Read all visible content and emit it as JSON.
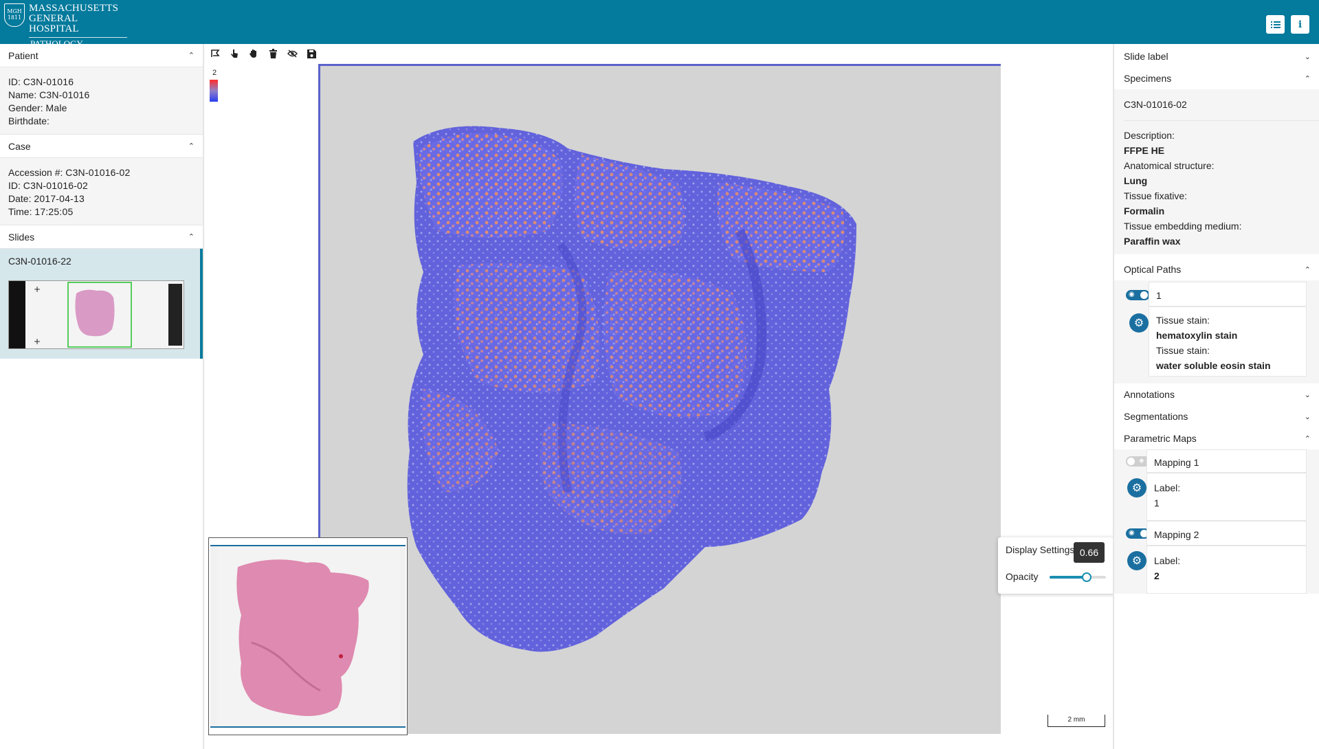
{
  "header": {
    "logo_line1": "MASSACHUSETTS",
    "logo_line2": "GENERAL HOSPITAL",
    "logo_line3": "PATHOLOGY",
    "logo_seal": "MGH 1811",
    "list_icon": "list-icon",
    "info_icon": "info-icon",
    "info_label": "i"
  },
  "patient": {
    "title": "Patient",
    "id_label": "ID:",
    "id": "C3N-01016",
    "name_label": "Name:",
    "name": "C3N-01016",
    "gender_label": "Gender:",
    "gender": "Male",
    "birthdate_label": "Birthdate:",
    "birthdate": ""
  },
  "case": {
    "title": "Case",
    "accession_label": "Accession #:",
    "accession": "C3N-01016-02",
    "id_label": "ID:",
    "id": "C3N-01016-02",
    "date_label": "Date:",
    "date": "2017-04-13",
    "time_label": "Time:",
    "time": "17:25:05"
  },
  "slides": {
    "title": "Slides",
    "items": [
      {
        "label": "C3N-01016-22"
      }
    ]
  },
  "toolbar": {
    "tools": [
      "draw-icon",
      "pointer-icon",
      "pan-icon",
      "trash-icon",
      "eye-slash-icon",
      "save-icon"
    ]
  },
  "viewer": {
    "legend_value": "2",
    "scale_label": "2 mm"
  },
  "display_settings": {
    "title": "Display Settings",
    "opacity_label": "Opacity",
    "opacity_value": "0.66",
    "opacity_fraction": 0.66
  },
  "right": {
    "slide_label": "Slide label",
    "specimens": "Specimens",
    "specimen_id": "C3N-01016-02",
    "description_label": "Description:",
    "description": "FFPE HE",
    "anatomical_label": "Anatomical structure:",
    "anatomical": "Lung",
    "fixative_label": "Tissue fixative:",
    "fixative": "Formalin",
    "embedding_label": "Tissue embedding medium:",
    "embedding": "Paraffin wax",
    "optical_paths": "Optical Paths",
    "optical_path_id": "1",
    "stain_label_1": "Tissue stain:",
    "stain_1": "hematoxylin stain",
    "stain_label_2": "Tissue stain:",
    "stain_2": "water soluble eosin stain",
    "annotations": "Annotations",
    "segmentations": "Segmentations",
    "parametric_maps": "Parametric Maps",
    "mapping1_name": "Mapping 1",
    "mapping1_label_key": "Label:",
    "mapping1_label": "1",
    "mapping2_name": "Mapping 2",
    "mapping2_label_key": "Label:",
    "mapping2_label": "2"
  },
  "colors": {
    "brand": "#047a9c",
    "accent": "#1a6fa0",
    "selected_row": "#d6e7ec"
  }
}
